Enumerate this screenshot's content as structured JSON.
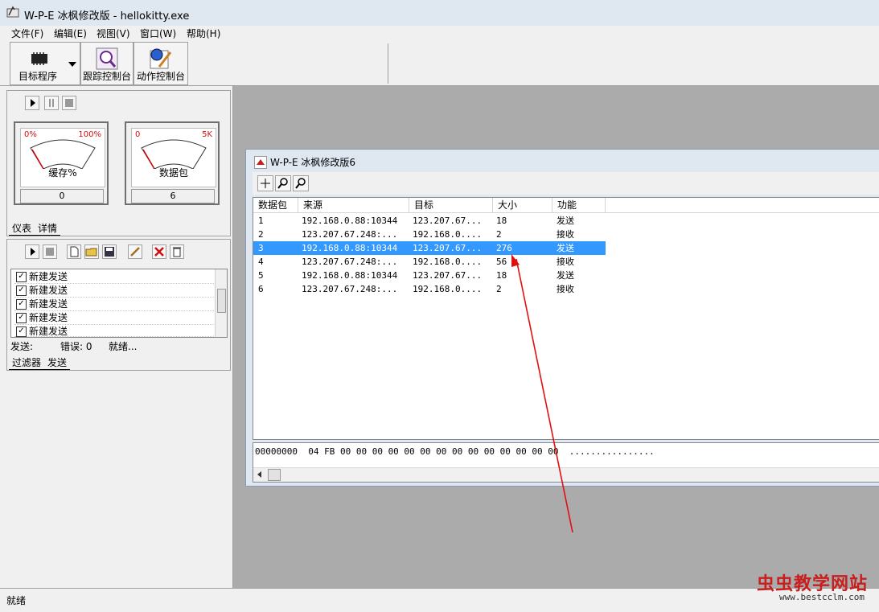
{
  "app": {
    "title": "W-P-E 冰枫修改版 - hellokitty.exe"
  },
  "menu": [
    "文件(F)",
    "编辑(E)",
    "视图(V)",
    "窗口(W)",
    "帮助(H)"
  ],
  "toolbar": {
    "target_label": "目标程序",
    "trace_label": "跟踪控制台",
    "action_label": "动作控制台"
  },
  "gauges": {
    "buffer": {
      "min": "0%",
      "max": "100%",
      "label": "缓存%",
      "value": "0"
    },
    "packets": {
      "min": "0",
      "max": "5K",
      "label": "数据包",
      "value": "6"
    }
  },
  "top_tabs": [
    "仪表",
    "详情"
  ],
  "filter_list": [
    "新建发送",
    "新建发送",
    "新建发送",
    "新建发送",
    "新建发送"
  ],
  "filter_status": {
    "send": "发送:",
    "error": "错误: 0",
    "ready": "就绪..."
  },
  "bottom_tabs": [
    "过滤器",
    "发送"
  ],
  "child": {
    "title": "W-P-E 冰枫修改版6",
    "columns": [
      "数据包",
      "来源",
      "目标",
      "大小",
      "功能"
    ],
    "rows": [
      {
        "id": "1",
        "src": "192.168.0.88:10344",
        "dst": "123.207.67...",
        "size": "18",
        "func": "发送"
      },
      {
        "id": "2",
        "src": "123.207.67.248:...",
        "dst": "192.168.0....",
        "size": "2",
        "func": "接收"
      },
      {
        "id": "3",
        "src": "192.168.0.88:10344",
        "dst": "123.207.67...",
        "size": "276",
        "func": "发送"
      },
      {
        "id": "4",
        "src": "123.207.67.248:...",
        "dst": "192.168.0....",
        "size": "56",
        "func": "接收"
      },
      {
        "id": "5",
        "src": "192.168.0.88:10344",
        "dst": "123.207.67...",
        "size": "18",
        "func": "发送"
      },
      {
        "id": "6",
        "src": "123.207.67.248:...",
        "dst": "192.168.0....",
        "size": "2",
        "func": "接收"
      }
    ],
    "selected_row": "3",
    "hex_line": "00000000  04 FB 00 00 00 00 00 00 00 00 00 00 00 00 00 00  ................"
  },
  "status": "就绪",
  "watermark": {
    "name": "虫虫教学网站",
    "url": "www.bestcclm.com"
  },
  "colors": {
    "selection": "#3399ff",
    "arrow": "#e01010",
    "mdi_bg": "#ababab"
  }
}
